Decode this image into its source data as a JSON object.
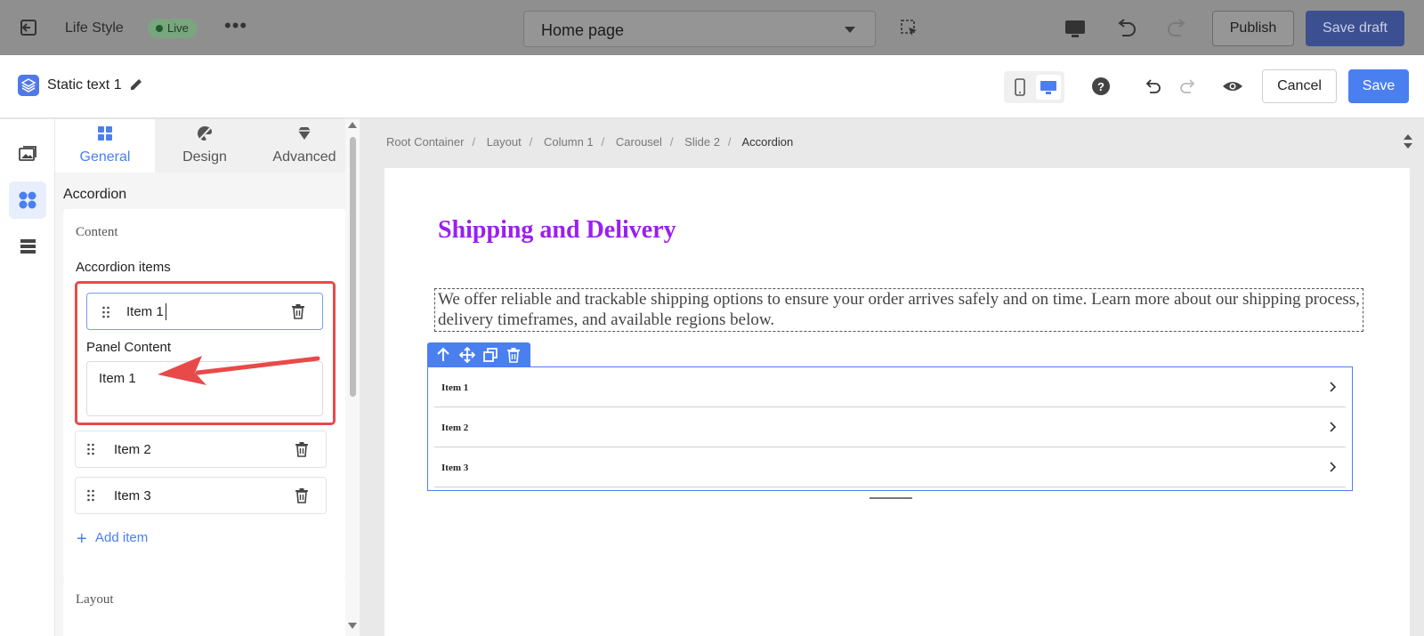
{
  "topbar": {
    "store_name": "Life Style",
    "status_badge": "Live",
    "page_select": "Home page",
    "publish_label": "Publish",
    "save_draft_label": "Save draft"
  },
  "editor": {
    "element_title": "Static text 1",
    "cancel_label": "Cancel",
    "save_label": "Save"
  },
  "panel": {
    "tabs": [
      {
        "label": "General",
        "icon": "grid-icon",
        "active": true
      },
      {
        "label": "Design",
        "icon": "palette-icon",
        "active": false
      },
      {
        "label": "Advanced",
        "icon": "diamond-icon",
        "active": false
      }
    ],
    "section_title": "Accordion",
    "content_label": "Content",
    "accordion_items_label": "Accordion items",
    "expanded_item": {
      "title_value": "Item 1",
      "panel_content_label": "Panel Content",
      "panel_content_value": "Item 1"
    },
    "items": [
      {
        "label": "Item 2"
      },
      {
        "label": "Item 3"
      }
    ],
    "add_item_label": "Add item",
    "layout_label": "Layout"
  },
  "breadcrumb": [
    "Root Container",
    "Layout",
    "Column 1",
    "Carousel",
    "Slide 2",
    "Accordion"
  ],
  "canvas": {
    "heading": "Shipping and Delivery",
    "paragraph": "We offer reliable and trackable shipping options to ensure your order arrives safely and on time. Learn more about our shipping process, delivery timeframes, and available regions below.",
    "accordion_items": [
      "Item 1",
      "Item 2",
      "Item 3"
    ]
  },
  "colors": {
    "accent": "#4a7ff0",
    "heading": "#9b1ff0",
    "highlight": "#e84a4a",
    "save_draft": "#3c4f91"
  }
}
